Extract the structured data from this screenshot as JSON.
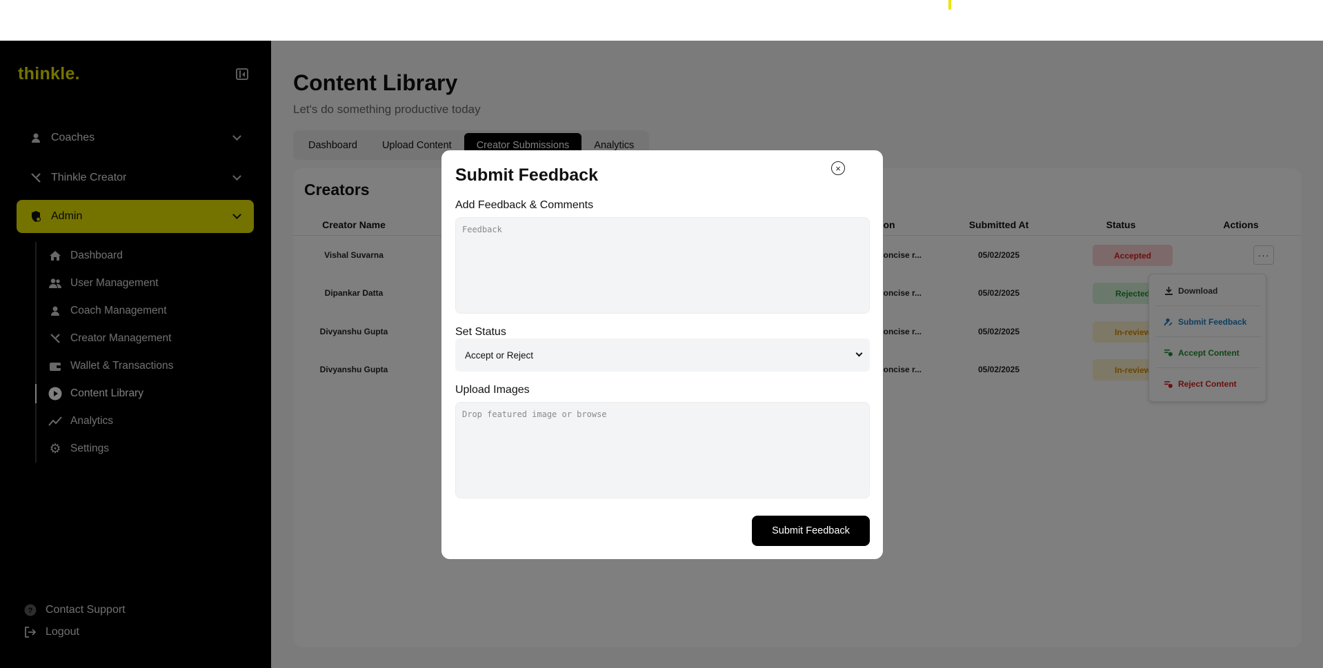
{
  "sidebar": {
    "logo": "thinkle.",
    "groups": [
      {
        "label": "Coaches",
        "icon": "user-icon"
      },
      {
        "label": "Thinkle Creator",
        "icon": "tools-icon"
      },
      {
        "label": "Admin",
        "icon": "shield-icon"
      }
    ],
    "items": [
      {
        "label": "Dashboard",
        "icon": "home-icon"
      },
      {
        "label": "User Management",
        "icon": "users-icon"
      },
      {
        "label": "Coach Management",
        "icon": "user-icon"
      },
      {
        "label": "Creator Management",
        "icon": "tools-icon"
      },
      {
        "label": "Wallet & Transactions",
        "icon": "wallet-icon"
      },
      {
        "label": "Content Library",
        "icon": "play-icon"
      },
      {
        "label": "Analytics",
        "icon": "chart-icon"
      },
      {
        "label": "Settings",
        "icon": "gear-icon"
      }
    ],
    "contact_support": "Contact Support",
    "logout": "Logout"
  },
  "header": {
    "title": "Content Library",
    "subtitle": "Let's do something productive today"
  },
  "tabs": [
    {
      "label": "Dashboard"
    },
    {
      "label": "Upload Content"
    },
    {
      "label": "Creator Submissions"
    },
    {
      "label": "Analytics"
    }
  ],
  "card": {
    "title": "Creators",
    "columns": {
      "creator_name": "Creator Name",
      "description": "on",
      "submitted_at": "Submitted At",
      "status": "Status",
      "actions": "Actions"
    },
    "rows": [
      {
        "name": "Vishal Suvarna",
        "description": "concise r...",
        "submitted_at": "05/02/2025",
        "status": "Accepted"
      },
      {
        "name": "Dipankar Datta",
        "description": "concise r...",
        "submitted_at": "05/02/2025",
        "status": "Rejected"
      },
      {
        "name": "Divyanshu Gupta",
        "description": "concise r...",
        "submitted_at": "05/02/2025",
        "status": "In-review"
      },
      {
        "name": "Divyanshu Gupta",
        "description": "concise r...",
        "submitted_at": "05/02/2025",
        "status": "In-review"
      }
    ],
    "more_label": "···"
  },
  "actions_menu": {
    "items": [
      {
        "label": "Download",
        "icon": "download-icon",
        "color": "#333333"
      },
      {
        "label": "Submit Feedback",
        "icon": "feedback-icon",
        "color": "#1a7fc1"
      },
      {
        "label": "Accept Content",
        "icon": "accept-icon",
        "color": "#1e8a2e"
      },
      {
        "label": "Reject Content",
        "icon": "reject-icon",
        "color": "#d41e1e"
      }
    ]
  },
  "modal": {
    "title": "Submit Feedback",
    "close_glyph": "×",
    "feedback_label": "Add Feedback & Comments",
    "feedback_placeholder": "Feedback",
    "status_label": "Set Status",
    "status_value": "Accept or Reject",
    "upload_label": "Upload Images",
    "upload_placeholder": "Drop featured image or browse",
    "submit_label": "Submit Feedback"
  },
  "colors": {
    "accent": "#e9e600",
    "sidebar_bg": "#000000",
    "accepted": "#d41e1e",
    "rejected": "#1e8a2e",
    "in_review": "#d48a00"
  }
}
